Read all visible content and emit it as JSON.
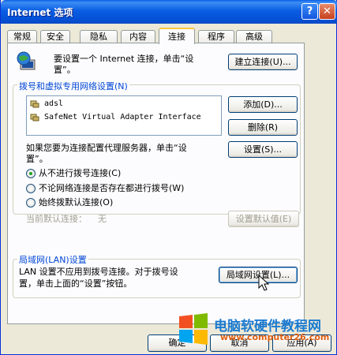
{
  "window": {
    "title": "Internet 选项",
    "help_glyph": "?",
    "close_glyph": "✕"
  },
  "tabs": [
    {
      "label": "常规"
    },
    {
      "label": "安全"
    },
    {
      "label": "隐私"
    },
    {
      "label": "内容"
    },
    {
      "label": "连接",
      "active": true
    },
    {
      "label": "程序"
    },
    {
      "label": "高级"
    }
  ],
  "setup": {
    "text_line1": "要设置一个 Internet 连接，单击“设",
    "text_line2": "置”。",
    "button": "建立连接(U)..."
  },
  "dialup": {
    "group_label": "拨号和虚拟专用网络设置(N)",
    "items": [
      {
        "label": "adsl"
      },
      {
        "label": "SafeNet Virtual Adapter Interface"
      }
    ],
    "add_button": "添加(D)...",
    "remove_button": "删除(R)",
    "settings_button": "设置(S)...",
    "proxy_text_line1": "如果您要为连接配置代理服务器，单击“设",
    "proxy_text_line2": "置”。",
    "radios": [
      {
        "label": "从不进行拨号连接(C)",
        "checked": true
      },
      {
        "label": "不论网络连接是否存在都进行拨号(W)",
        "checked": false
      },
      {
        "label": "始终拨默认连接(O)",
        "checked": false
      }
    ],
    "current_default_label": "当前默认连接：",
    "current_default_value": "无",
    "set_default_button": "设置默认值(E)"
  },
  "lan": {
    "group_label": "局域网(LAN)设置",
    "text_line1": "LAN 设置不应用到拨号连接。对于拨号设",
    "text_line2": "置，单击上面的“设置”按钮。",
    "button": "局域网设置(L)..."
  },
  "footer": {
    "ok_button": "确定",
    "cancel_button": "取消",
    "apply_button": "应用(A)"
  },
  "watermark": {
    "text": "电脑软硬件教程网",
    "url": "www.computer26.com"
  },
  "colors": {
    "title_bar": "#0a5ee2",
    "group_label": "#0046d5",
    "watermark_text": "#1a7ad0"
  }
}
